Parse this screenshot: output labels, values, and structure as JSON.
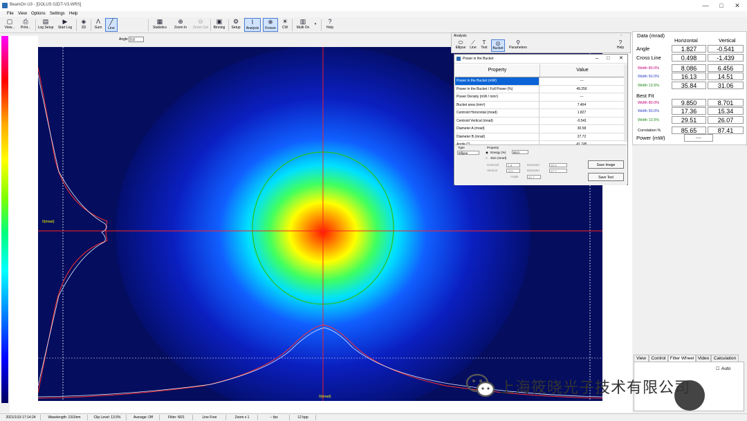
{
  "window": {
    "title": "BeamOn U3 - [DOLUS 02DT-V3.WRS]",
    "controls": [
      "—",
      "□",
      "✕"
    ]
  },
  "menu": [
    "File",
    "View",
    "Options",
    "Settings",
    "Help"
  ],
  "toolbar": {
    "buttons": [
      {
        "label": "View...",
        "icon": "view-icon"
      },
      {
        "label": "Print...",
        "icon": "print-icon"
      },
      {
        "label": "Log Setup",
        "icon": "log-setup-icon"
      },
      {
        "label": "Start Log",
        "icon": "start-log-icon"
      },
      {
        "label": "3D",
        "icon": "3d-icon"
      },
      {
        "label": "Gum",
        "icon": "gum-icon"
      },
      {
        "label": "Line",
        "icon": "line-icon"
      },
      {
        "label": "Statistics",
        "icon": "statistics-icon"
      },
      {
        "label": "Zoom In",
        "icon": "zoom-in-icon"
      },
      {
        "label": "Zoom Out",
        "icon": "zoom-out-icon"
      },
      {
        "label": "Binning",
        "icon": "binning-icon"
      },
      {
        "label": "Setup",
        "icon": "setup-icon"
      },
      {
        "label": "Analysis",
        "icon": "analysis-icon"
      },
      {
        "label": "Freeze",
        "icon": "freeze-icon"
      },
      {
        "label": "CW",
        "icon": "cw-icon"
      },
      {
        "label": "Multi On",
        "icon": "multi-on-icon"
      },
      {
        "label": "Help",
        "icon": "help-icon"
      }
    ],
    "angle_label": "Angle",
    "angle_value": "0.0"
  },
  "profile": {
    "vertical_axis_label": "0(mrad)",
    "horizontal_axis_label": "0(mrad)"
  },
  "analysis": {
    "title": "Analysis",
    "buttons": [
      "Ellipse",
      "Line",
      "Text",
      "Bucket",
      "Parameters",
      "Help"
    ]
  },
  "pib": {
    "title": "Power in the Bucket",
    "col_property": "Property",
    "col_value": "Value",
    "rows": [
      {
        "p": "Power in the Bucket (mW)",
        "v": "---"
      },
      {
        "p": "Power in the Bucket / Full Power (%)",
        "v": "49.256"
      },
      {
        "p": "Power Density (mW / mm²)",
        "v": "---"
      },
      {
        "p": "Bucket area (mm²)",
        "v": "7.464"
      },
      {
        "p": "Centroid Horizontal (mrad)",
        "v": "1.827"
      },
      {
        "p": "Centroid Vertical (mrad)",
        "v": "-0.541"
      },
      {
        "p": "Diameter A (mrad)",
        "v": "30.58"
      },
      {
        "p": "Diameter B (mrad)",
        "v": "27.72"
      },
      {
        "p": "Angle (°)",
        "v": "41.745"
      }
    ],
    "type_label": "Type",
    "type_value": "Ellipse",
    "property_label": "Property",
    "energy_label": "Energy (%)",
    "energy_value": "50.0",
    "size_label": "Size (mrad)",
    "centroid_label": "Centroid",
    "horizontal_label": "Horizontal",
    "vertical_label": "Vertical",
    "centroid_h": "1.8",
    "centroid_v": "-0.5",
    "diameter_label": "Diameter",
    "diameter_a": "30.6",
    "diameter_b": "27.7",
    "angle_label": "Angle",
    "angle_value": "41.7",
    "save_image": "Save Image",
    "save_text": "Save Text"
  },
  "data": {
    "title": "Data (mrad)",
    "col_h": "Horizontal",
    "col_v": "Vertical",
    "rows": [
      {
        "label": "Angle",
        "h": "1.827",
        "v": "-0.541",
        "color": "#000000",
        "kind": "main"
      },
      {
        "label": "Cross Line",
        "h": "0.498",
        "v": "-1.439",
        "color": "#000000",
        "kind": "main"
      },
      {
        "label": "Width 80.0%",
        "h": "8.086",
        "v": "6.456",
        "color": "#c0007a",
        "kind": "sub"
      },
      {
        "label": "Width 50.0%",
        "h": "16.13",
        "v": "14.51",
        "color": "#2a3fbf",
        "kind": "sub"
      },
      {
        "label": "Width 13.5%",
        "h": "35.84",
        "v": "31.06",
        "color": "#1a8a1a",
        "kind": "sub"
      },
      {
        "label": "Best Fit",
        "h": "",
        "v": "",
        "color": "#000000",
        "kind": "heading"
      },
      {
        "label": "Width 80.0%",
        "h": "9.850",
        "v": "8.701",
        "color": "#c0007a",
        "kind": "sub"
      },
      {
        "label": "Width 50.0%",
        "h": "17.36",
        "v": "15.34",
        "color": "#2a3fbf",
        "kind": "sub"
      },
      {
        "label": "Width 13.5%",
        "h": "29.51",
        "v": "26.07",
        "color": "#1a8a1a",
        "kind": "sub"
      },
      {
        "label": "Correlation %",
        "h": "85.65",
        "v": "87.41",
        "color": "#000000",
        "kind": "sub"
      }
    ],
    "power_label": "Power (mW)",
    "power_value": "-----"
  },
  "tabs": [
    "View",
    "Control",
    "Filter Wheel",
    "Video",
    "Calculation"
  ],
  "auto_label": "Auto",
  "statusbar": [
    "2021/1/19 17:14:24",
    "Wavelength: 1310nm",
    "Clip Level: 13.5%",
    "Average: Off",
    "Filter: ND1",
    "Line Free",
    "Zoom x 1",
    "-- fps",
    "12 bpp"
  ],
  "watermark": "上海筱晓光子技术有限公司"
}
